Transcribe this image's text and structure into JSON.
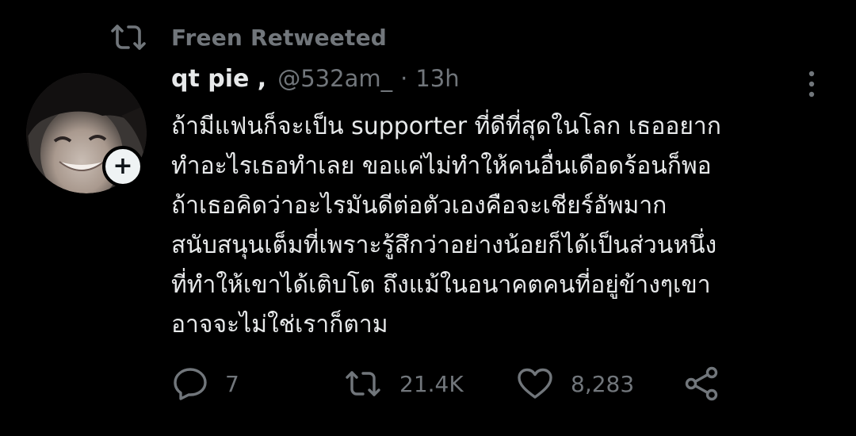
{
  "retweet_context": {
    "label": "Freen Retweeted",
    "icon": "retweet-icon"
  },
  "tweet": {
    "display_name": "qt pie ,",
    "handle": "@532am_",
    "separator": "·",
    "time": "13h",
    "more_icon": "more-vertical-icon",
    "follow_icon": "plus-icon",
    "text_lines": [
      "ถ้ามีแฟนก็จะเป็น supporter ที่ดีที่สุดในโลก เธออยาก",
      "ทำอะไรเธอทำเลย ขอแค่ไม่ทำให้คนอื่นเดือดร้อนก็พอ",
      "ถ้าเธอคิดว่าอะไรมันดีต่อตัวเองคือจะเชียร์อัพมาก",
      "สนับสนุนเต็มที่เพราะรู้สึกว่าอย่างน้อยก็ได้เป็นส่วนหนึ่ง",
      "ที่ทำให้เขาได้เติบโต ถึงแม้ในอนาคตคนที่อยู่ข้างๆเขา",
      "อาจจะไม่ใช่เราก็ตาม"
    ]
  },
  "actions": {
    "reply": {
      "icon": "reply-icon",
      "count": "7"
    },
    "retweet": {
      "icon": "retweet-icon",
      "count": "21.4K"
    },
    "like": {
      "icon": "heart-icon",
      "count": "8,283"
    },
    "share": {
      "icon": "share-icon"
    }
  },
  "colors": {
    "background": "#000000",
    "primary_text": "#e7e9ea",
    "secondary_text": "#71767b"
  }
}
